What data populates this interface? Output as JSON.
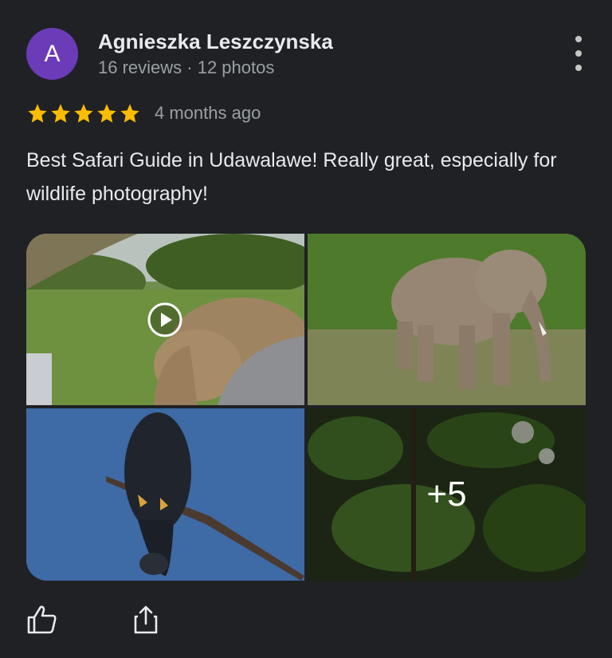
{
  "review": {
    "avatar_letter": "A",
    "avatar_color": "#6b3bb8",
    "reviewer_name": "Agnieszka Leszczynska",
    "reviewer_meta": "16 reviews · 12 photos",
    "rating": 5,
    "rating_max": 5,
    "time_ago": "4 months ago",
    "text": "Best Safari Guide in Udawalawe! Really great, especially for wildlife photography!"
  },
  "photos": {
    "items": [
      {
        "subject": "elephant-video",
        "is_video": true
      },
      {
        "subject": "elephant"
      },
      {
        "subject": "eagle-on-branch"
      },
      {
        "subject": "foliage"
      }
    ],
    "more_count_label": "+5"
  },
  "colors": {
    "background": "#202124",
    "star": "#fbbc04",
    "secondary_text": "#9aa0a6"
  },
  "icons": {
    "more": "more-vert-icon",
    "like": "thumb-up-icon",
    "share": "share-icon",
    "play": "play-icon"
  }
}
